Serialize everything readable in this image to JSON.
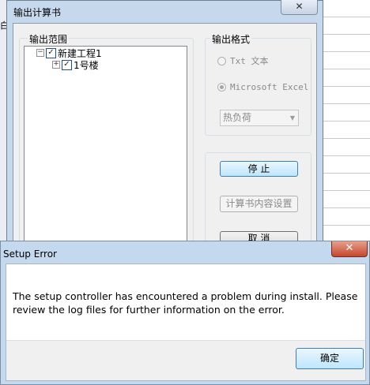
{
  "background": {
    "left_fragment_label": "白"
  },
  "main_dialog": {
    "title": "输出计算书",
    "close_symbol": "✕",
    "scope_group_label": "输出范围",
    "tree": {
      "root": {
        "toggle": "−",
        "check": "✓",
        "label": "新建工程1"
      },
      "child": {
        "toggle": "+",
        "check": "✓",
        "label": "1号楼"
      }
    },
    "format_group_label": "输出格式",
    "radio_txt": "Txt 文本",
    "radio_excel": "Microsoft Excel",
    "select_value": "热负荷",
    "select_arrow": "▼",
    "stop_button": "停 止",
    "settings_button": "计算书内容设置",
    "cancel_button": "取 消"
  },
  "error_dialog": {
    "title": "Setup Error",
    "close_symbol": "✕",
    "message": "The setup controller has encountered a problem during install.  Please review the log files for further information on the error.",
    "ok_button": "确定"
  },
  "colors": {
    "dialog_frame": "#c6d8ec",
    "error_frame": "#c4d8ee",
    "close_red": "#c7462b",
    "default_button": "#3c7fb1"
  }
}
